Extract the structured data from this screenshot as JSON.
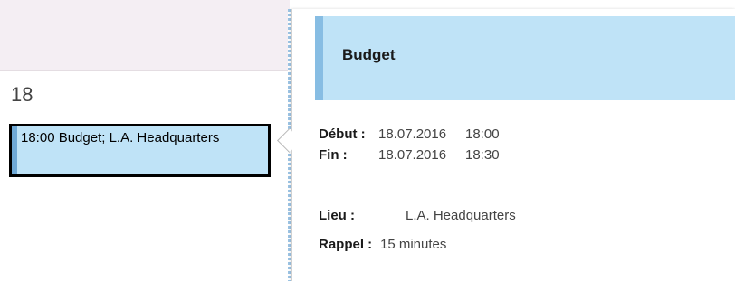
{
  "calendar": {
    "day_number": "18",
    "appointment_text": "18:00 Budget; L.A. Headquarters"
  },
  "popup": {
    "title": "Budget",
    "start_label": "Début :",
    "start_date": "18.07.2016",
    "start_time": "18:00",
    "end_label": "Fin :",
    "end_date": "18.07.2016",
    "end_time": "18:30",
    "location_label": "Lieu :",
    "location_value": "L.A. Headquarters",
    "reminder_label": "Rappel :",
    "reminder_value": "15 minutes"
  },
  "colors": {
    "appointment_fill": "#bfe3f7",
    "appointment_stripe": "#6fa9d6",
    "header_band": "#f4eef3",
    "selection_border": "#000000"
  }
}
